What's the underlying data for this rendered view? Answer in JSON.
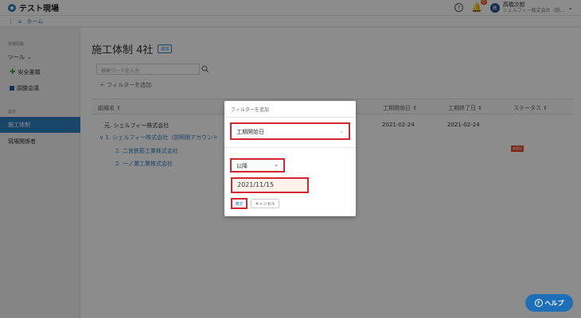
{
  "header": {
    "app_title": "テスト現場",
    "help_icon": "question-circle-icon",
    "notification_count": "0",
    "user_avatar_initial": "高",
    "user_name": "高橋次郎",
    "user_company": "シェルフィー株式会社（説..."
  },
  "breadcrumb": {
    "home_label": "ホーム"
  },
  "sidebar": {
    "section1": "現場情報",
    "tools_label": "ツール",
    "items": [
      {
        "label": "安全書類"
      },
      {
        "label": "調整会議"
      }
    ],
    "section2": "設定",
    "active_item": "施工体制",
    "last_item": "現場関係者"
  },
  "main": {
    "title": "施工体制 4社",
    "add_tag": "追加",
    "search_placeholder": "検索ワードを入力",
    "filter_add": "＋ フィルターを追加",
    "columns": [
      "組織名 ⇕",
      "工期開始日 ⇕",
      "工期終了日 ⇕",
      "ステータス ⇕"
    ],
    "rows": [
      {
        "name": "元. シェルフィー株式会社",
        "start": "2021-02-24",
        "end": "2021-02-24"
      },
      {
        "name": "∨ 1. シェルフィー株式会社（説明用アカウント",
        "start": "",
        "end": ""
      },
      {
        "name": "2. 二宮鉄筋工業株式会社",
        "start": "",
        "end": ""
      },
      {
        "name": "2. 一ノ瀬工業株式会社",
        "start": "",
        "end": ""
      }
    ],
    "status_badge": "未提出"
  },
  "modal": {
    "title": "フィルターを追加",
    "field_value": "工期開始日",
    "condition_value": "以降",
    "date_value": "2021/11/15",
    "ok_label": "確定",
    "cancel_label": "キャンセル"
  },
  "help_button": {
    "label": "ヘルプ"
  },
  "colors": {
    "accent": "#2f7fc1",
    "highlight": "#d3262f",
    "help": "#1d6fb8"
  }
}
